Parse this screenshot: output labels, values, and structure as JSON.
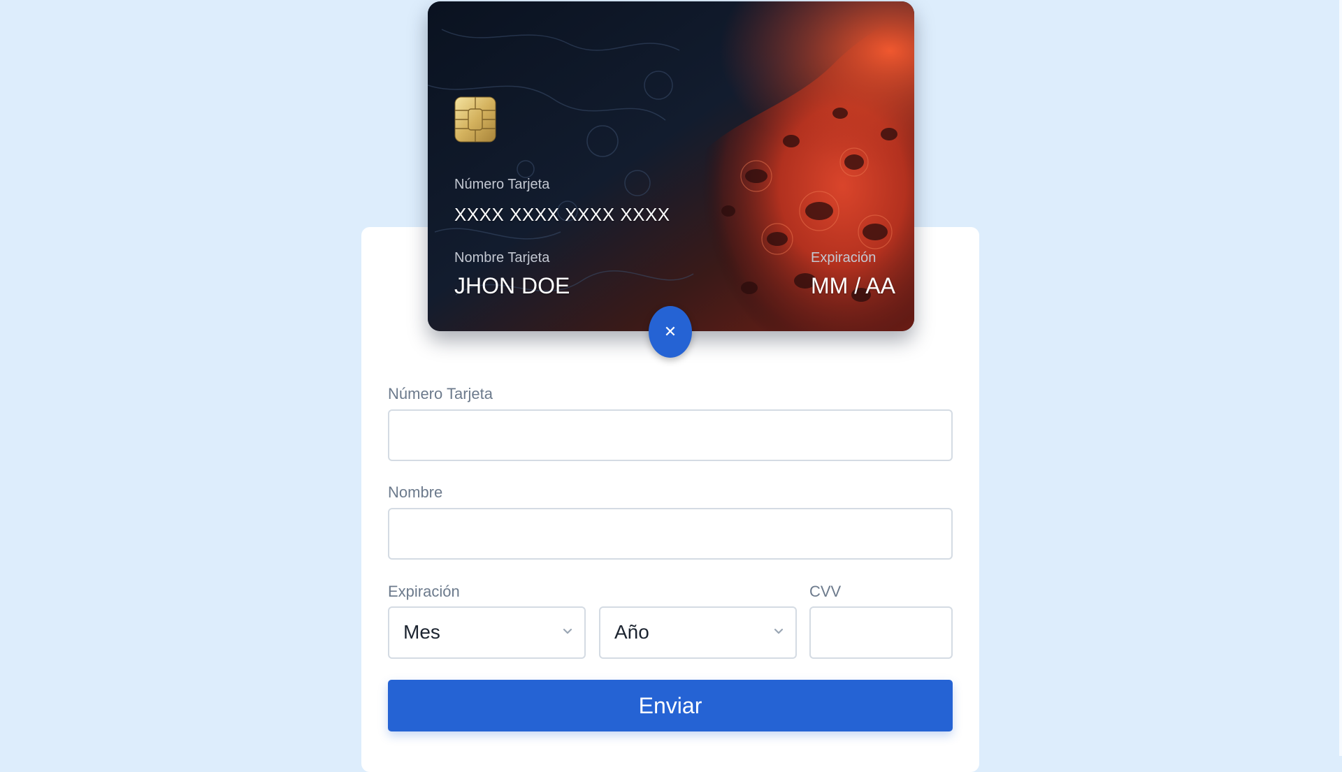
{
  "card": {
    "number_label": "Número Tarjeta",
    "number_value": "XXXX XXXX XXXX XXXX",
    "name_label": "Nombre Tarjeta",
    "name_value": "JHON DOE",
    "expiry_label": "Expiración",
    "expiry_value": "MM / AA",
    "close_glyph": "✕"
  },
  "form": {
    "number_label": "Número Tarjeta",
    "number_value": "",
    "name_label": "Nombre",
    "name_value": "",
    "expiry_label": "Expiración",
    "month_selected": "Mes",
    "year_selected": "Año",
    "cvv_label": "CVV",
    "cvv_value": "",
    "submit_label": "Enviar"
  },
  "icons": {
    "close": "close-icon",
    "chip": "chip-icon",
    "chevron": "chevron-down-icon"
  },
  "colors": {
    "background": "#ddedfc",
    "accent": "#2563d4",
    "panel": "#ffffff",
    "label": "#6c7a8c",
    "border": "#d4dbe3"
  }
}
